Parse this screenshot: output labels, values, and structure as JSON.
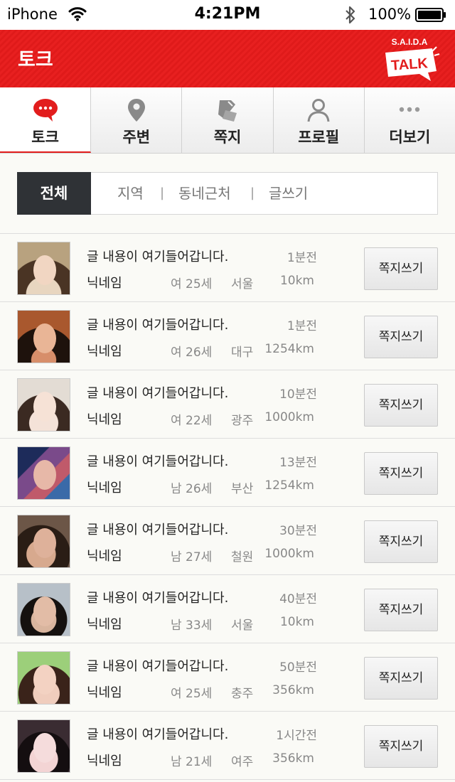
{
  "status": {
    "carrier": "iPhone",
    "time": "4:21PM",
    "battery": "100%"
  },
  "header": {
    "title": "토크",
    "logo_top": "S.A.I.D.A",
    "logo_main": "TALK"
  },
  "nav": [
    {
      "label": "토크",
      "icon": "chat-bubble-icon",
      "active": true
    },
    {
      "label": "주변",
      "icon": "location-pin-icon",
      "active": false
    },
    {
      "label": "쪽지",
      "icon": "note-icon",
      "active": false
    },
    {
      "label": "프로필",
      "icon": "person-icon",
      "active": false
    },
    {
      "label": "더보기",
      "icon": "more-dots-icon",
      "active": false
    }
  ],
  "filter": {
    "all": "전체",
    "options": [
      "지역",
      "동네근처",
      "글쓰기"
    ]
  },
  "colors": {
    "accent": "#e21d1d",
    "dark": "#2f3236"
  },
  "posts": [
    {
      "message": "글 내용이 여기들어갑니다.",
      "time": "1분전",
      "nickname": "닉네임",
      "age": "여 25세",
      "city": "서울",
      "distance": "10km",
      "button": "쪽지쓰기"
    },
    {
      "message": "글 내용이 여기들어갑니다.",
      "time": "1분전",
      "nickname": "닉네임",
      "age": "여 26세",
      "city": "대구",
      "distance": "1254km",
      "button": "쪽지쓰기"
    },
    {
      "message": "글 내용이 여기들어갑니다.",
      "time": "10분전",
      "nickname": "닉네임",
      "age": "여 22세",
      "city": "광주",
      "distance": "1000km",
      "button": "쪽지쓰기"
    },
    {
      "message": "글 내용이 여기들어갑니다.",
      "time": "13분전",
      "nickname": "닉네임",
      "age": "남 26세",
      "city": "부산",
      "distance": "1254km",
      "button": "쪽지쓰기"
    },
    {
      "message": "글 내용이 여기들어갑니다.",
      "time": "30분전",
      "nickname": "닉네임",
      "age": "남 27세",
      "city": "철원",
      "distance": "1000km",
      "button": "쪽지쓰기"
    },
    {
      "message": "글 내용이 여기들어갑니다.",
      "time": "40분전",
      "nickname": "닉네임",
      "age": "남 33세",
      "city": "서울",
      "distance": "10km",
      "button": "쪽지쓰기"
    },
    {
      "message": "글 내용이 여기들어갑니다.",
      "time": "50분전",
      "nickname": "닉네임",
      "age": "여 25세",
      "city": "충주",
      "distance": "356km",
      "button": "쪽지쓰기"
    },
    {
      "message": "글 내용이 여기들어갑니다.",
      "time": "1시간전",
      "nickname": "닉네임",
      "age": "남 21세",
      "city": "여주",
      "distance": "356km",
      "button": "쪽지쓰기"
    }
  ]
}
